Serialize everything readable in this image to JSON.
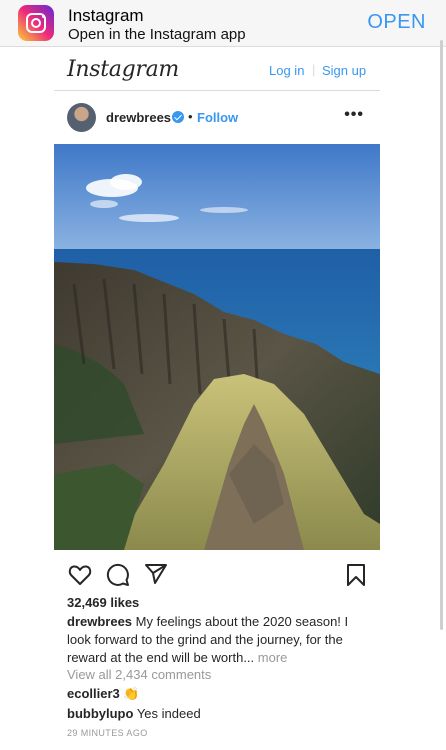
{
  "banner": {
    "app_name": "Instagram",
    "subtitle": "Open in the Instagram app",
    "open_label": "OPEN",
    "icon": "instagram-app-icon"
  },
  "header": {
    "logo_text": "Instagram",
    "login_label": "Log in",
    "separator": "|",
    "signup_label": "Sign up"
  },
  "post": {
    "username": "drewbrees",
    "verified": true,
    "bullet": "•",
    "follow_label": "Follow",
    "more_icon": "•••",
    "likes": "32,469 likes",
    "caption_user": "drewbrees",
    "caption_text": "My feelings about the 2020 season! I look forward to the grind and the journey, for the reward at the end will be worth...",
    "caption_more": "more",
    "view_all_comments": "View all 2,434 comments",
    "comments": [
      {
        "user": "ecollier3",
        "text": "👏"
      },
      {
        "user": "bubbylupo",
        "text": "Yes indeed"
      }
    ],
    "timestamp": "29 MINUTES AGO"
  },
  "colors": {
    "link_blue": "#3897f0",
    "text": "#262626",
    "muted": "#999999"
  }
}
